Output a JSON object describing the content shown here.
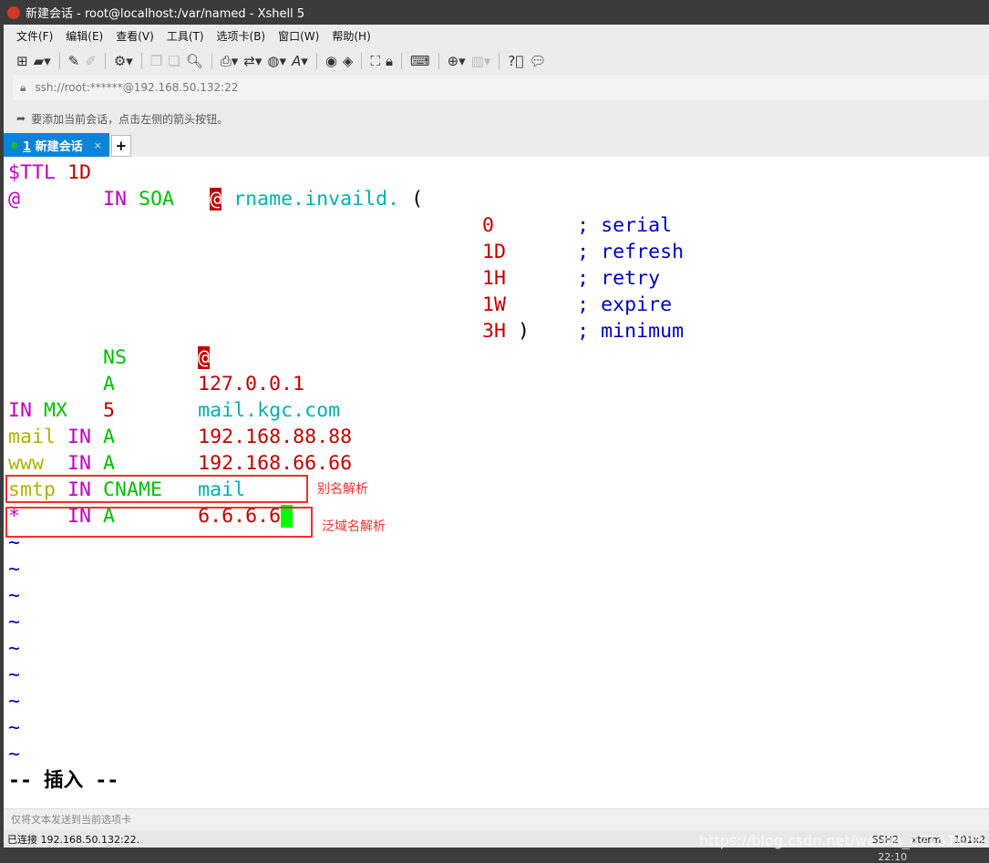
{
  "title": "新建会话 - root@localhost:/var/named - Xshell 5",
  "menu": [
    "文件(F)",
    "编辑(E)",
    "查看(V)",
    "工具(T)",
    "选项卡(B)",
    "窗口(W)",
    "帮助(H)"
  ],
  "address": "ssh://root:******@192.168.50.132:22",
  "hint": "要添加当前会话，点击左侧的箭头按钮。",
  "tab": {
    "number": "1",
    "label": "新建会话",
    "close": "×",
    "add": "+"
  },
  "terminal": [
    [
      [
        "$TTL ",
        "mag"
      ],
      [
        "1D",
        "red"
      ]
    ],
    [
      [
        "@",
        "mag"
      ],
      [
        "       ",
        ""
      ],
      [
        "IN ",
        "mag"
      ],
      [
        "SOA",
        "grn"
      ],
      [
        "   ",
        ""
      ],
      [
        "@",
        "atbg"
      ],
      [
        " ",
        ""
      ],
      [
        "rname.invaild.",
        "cyn"
      ],
      [
        " (",
        "blk"
      ]
    ],
    [
      [
        "                                        ",
        ""
      ],
      [
        "0",
        "red"
      ],
      [
        "       ",
        ""
      ],
      [
        "; serial",
        "blu"
      ]
    ],
    [
      [
        "                                        ",
        ""
      ],
      [
        "1D",
        "red"
      ],
      [
        "      ",
        ""
      ],
      [
        "; refresh",
        "blu"
      ]
    ],
    [
      [
        "                                        ",
        ""
      ],
      [
        "1H",
        "red"
      ],
      [
        "      ",
        ""
      ],
      [
        "; retry",
        "blu"
      ]
    ],
    [
      [
        "                                        ",
        ""
      ],
      [
        "1W",
        "red"
      ],
      [
        "      ",
        ""
      ],
      [
        "; expire",
        "blu"
      ]
    ],
    [
      [
        "                                        ",
        ""
      ],
      [
        "3H",
        "red"
      ],
      [
        " )    ",
        "blk"
      ],
      [
        "; minimum",
        "blu"
      ]
    ],
    [
      [
        "        ",
        ""
      ],
      [
        "NS",
        "grn"
      ],
      [
        "      ",
        ""
      ],
      [
        "@",
        "atbg"
      ]
    ],
    [
      [
        "        ",
        ""
      ],
      [
        "A",
        "grn"
      ],
      [
        "       ",
        ""
      ],
      [
        "127.0.0.1",
        "red"
      ]
    ],
    [
      [
        "IN ",
        "mag"
      ],
      [
        "MX",
        "grn"
      ],
      [
        "   ",
        ""
      ],
      [
        "5",
        "red"
      ],
      [
        "       ",
        ""
      ],
      [
        "mail.kgc.com",
        "cyn"
      ]
    ],
    [
      [
        "mail ",
        "olv"
      ],
      [
        "IN ",
        "mag"
      ],
      [
        "A",
        "grn"
      ],
      [
        "       ",
        ""
      ],
      [
        "192.168.88.88",
        "red"
      ]
    ],
    [
      [
        "www  ",
        "olv"
      ],
      [
        "IN ",
        "mag"
      ],
      [
        "A",
        "grn"
      ],
      [
        "       ",
        ""
      ],
      [
        "192.168.66.66",
        "red"
      ]
    ],
    [
      [
        "smtp ",
        "olv"
      ],
      [
        "IN ",
        "mag"
      ],
      [
        "CNAME",
        "grn"
      ],
      [
        "   ",
        ""
      ],
      [
        "mail",
        "cyn"
      ]
    ],
    [
      [
        "*",
        "mag"
      ],
      [
        "    ",
        ""
      ],
      [
        "IN ",
        "mag"
      ],
      [
        "A",
        "grn"
      ],
      [
        "       ",
        ""
      ],
      [
        "6.6.6.6",
        "red"
      ],
      [
        " ",
        "cur"
      ]
    ],
    [
      [
        "~",
        "blu"
      ]
    ],
    [
      [
        "~",
        "blu"
      ]
    ],
    [
      [
        "~",
        "blu"
      ]
    ],
    [
      [
        "~",
        "blu"
      ]
    ],
    [
      [
        "~",
        "blu"
      ]
    ],
    [
      [
        "~",
        "blu"
      ]
    ],
    [
      [
        "~",
        "blu"
      ]
    ],
    [
      [
        "~",
        "blu"
      ]
    ],
    [
      [
        "~",
        "blu"
      ]
    ],
    [
      [
        "-- 插入 --",
        "bold"
      ]
    ]
  ],
  "annotations": {
    "cname": "别名解析",
    "wildcard": "泛域名解析"
  },
  "sendbar": "仅将文本发送到当前选项卡",
  "status": {
    "connected": "已连接 192.168.50.132:22.",
    "protocol": "SSH2",
    "term": "xterm",
    "size": "101x2"
  },
  "watermark": "https://blog.csdn.net/weixin_47151650",
  "clock": "22:10"
}
